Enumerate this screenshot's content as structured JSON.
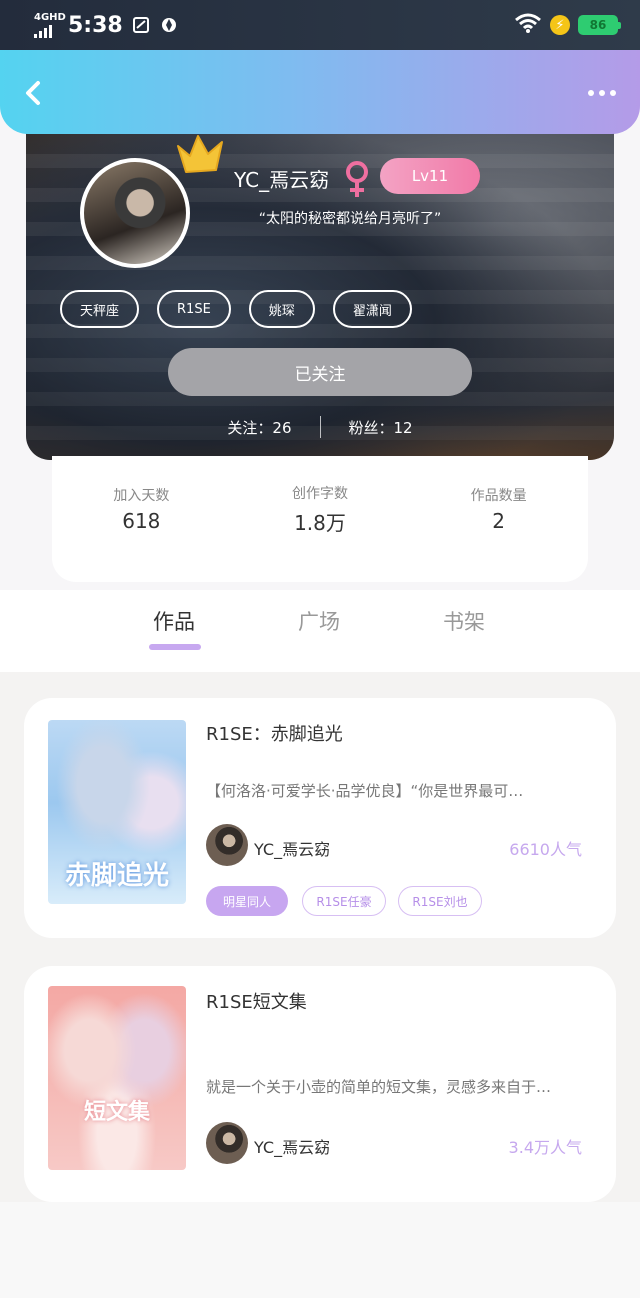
{
  "status_bar": {
    "network": "4GHD",
    "time": "5:38",
    "battery": "86"
  },
  "profile": {
    "username": "YC_焉云窈",
    "level": "Lv11",
    "signature": "“太阳的秘密都说给月亮听了”",
    "tags": [
      "天秤座",
      "R1SE",
      "姚琛",
      "翟潇闻"
    ],
    "follow_button": "已关注",
    "following": "关注：26",
    "followers": "粉丝：12"
  },
  "stats": [
    {
      "label": "加入天数",
      "value": "618"
    },
    {
      "label": "创作字数",
      "value": "1.8万"
    },
    {
      "label": "作品数量",
      "value": "2"
    }
  ],
  "tabs": [
    "作品",
    "广场",
    "书架"
  ],
  "active_tab": "作品",
  "works": [
    {
      "cover_title": "赤脚追光",
      "title": "R1SE：赤脚追光",
      "description": "【何洛洛·可爱学长·品学优良】“你是世界最可…",
      "author": "YC_焉云窈",
      "popularity": "6610人气",
      "tags": [
        "明星同人",
        "R1SE任豪",
        "R1SE刘也"
      ]
    },
    {
      "cover_title": "短文集",
      "title": "R1SE短文集",
      "description": "就是一个关于小壶的简单的短文集，灵感多来自于…",
      "author": "YC_焉云窈",
      "popularity": "3.4万人气"
    }
  ],
  "colors": {
    "accent": "#c7a8f0",
    "header_start": "#54d3f0",
    "header_end": "#b49be8",
    "level_badge": "#f27aa8",
    "gender": "#ef6fa0"
  }
}
